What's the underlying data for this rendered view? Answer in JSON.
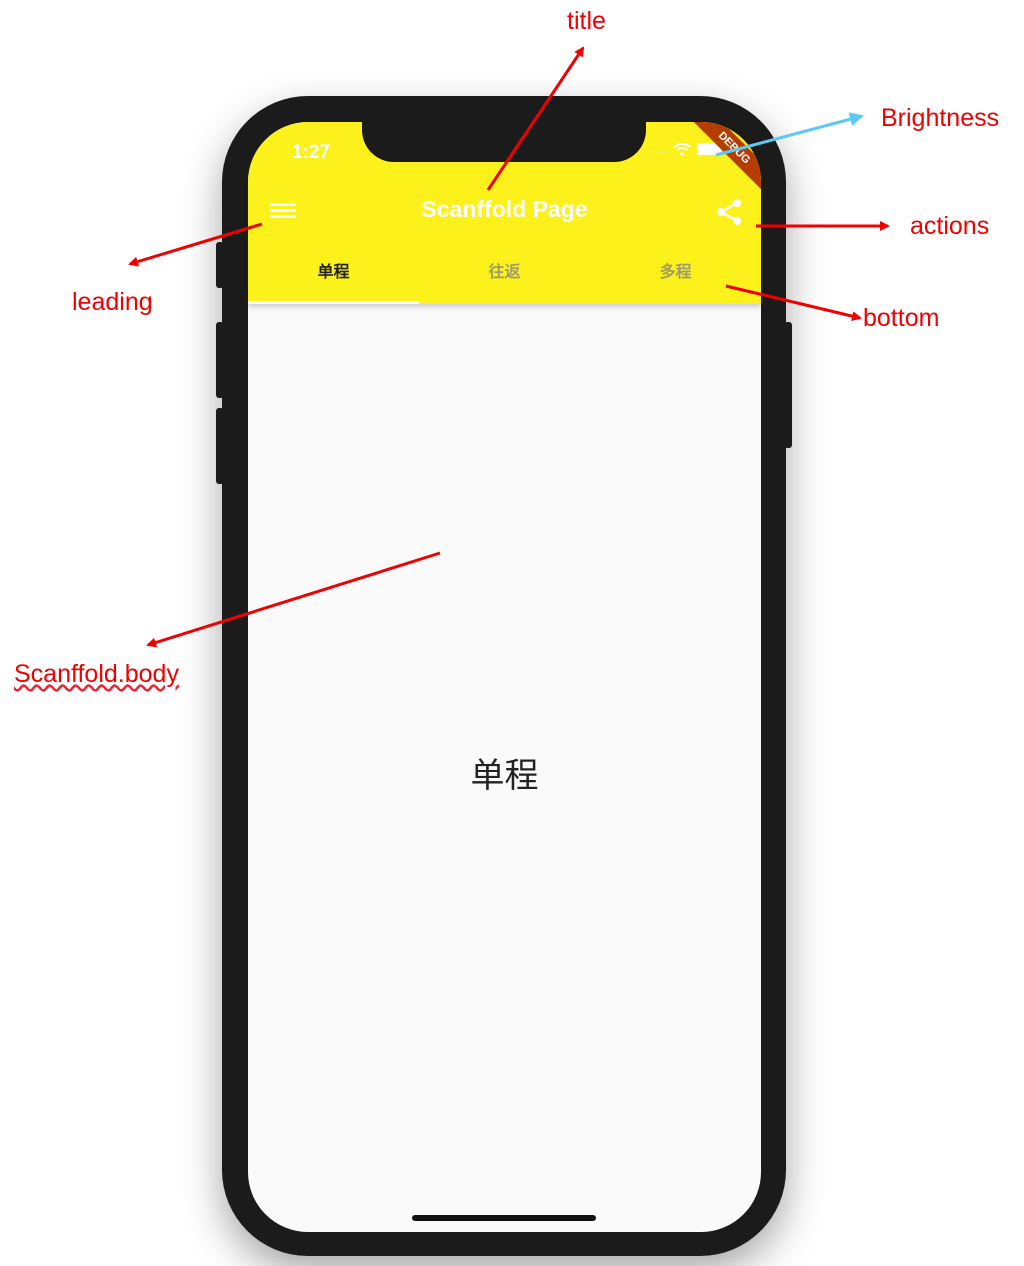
{
  "status_bar": {
    "time": "1:27",
    "signal": "....",
    "debug_banner": "DEBUG"
  },
  "app_bar": {
    "title": "Scanffold Page",
    "background": "#fdf11b",
    "leading_icon": "menu-icon",
    "action_icon": "share-icon"
  },
  "tabs": [
    {
      "label": "单程",
      "active": true
    },
    {
      "label": "往返",
      "active": false
    },
    {
      "label": "多程",
      "active": false
    }
  ],
  "body": {
    "text": "单程"
  },
  "annotations": {
    "title": "title",
    "brightness": "Brightness",
    "actions": "actions",
    "leading": "leading",
    "bottom": "bottom",
    "body": "Scanffold.body"
  },
  "colors": {
    "arrow_red": "#f00000",
    "arrow_blue": "#5bc8f5",
    "ribbon": "#b53d00"
  }
}
